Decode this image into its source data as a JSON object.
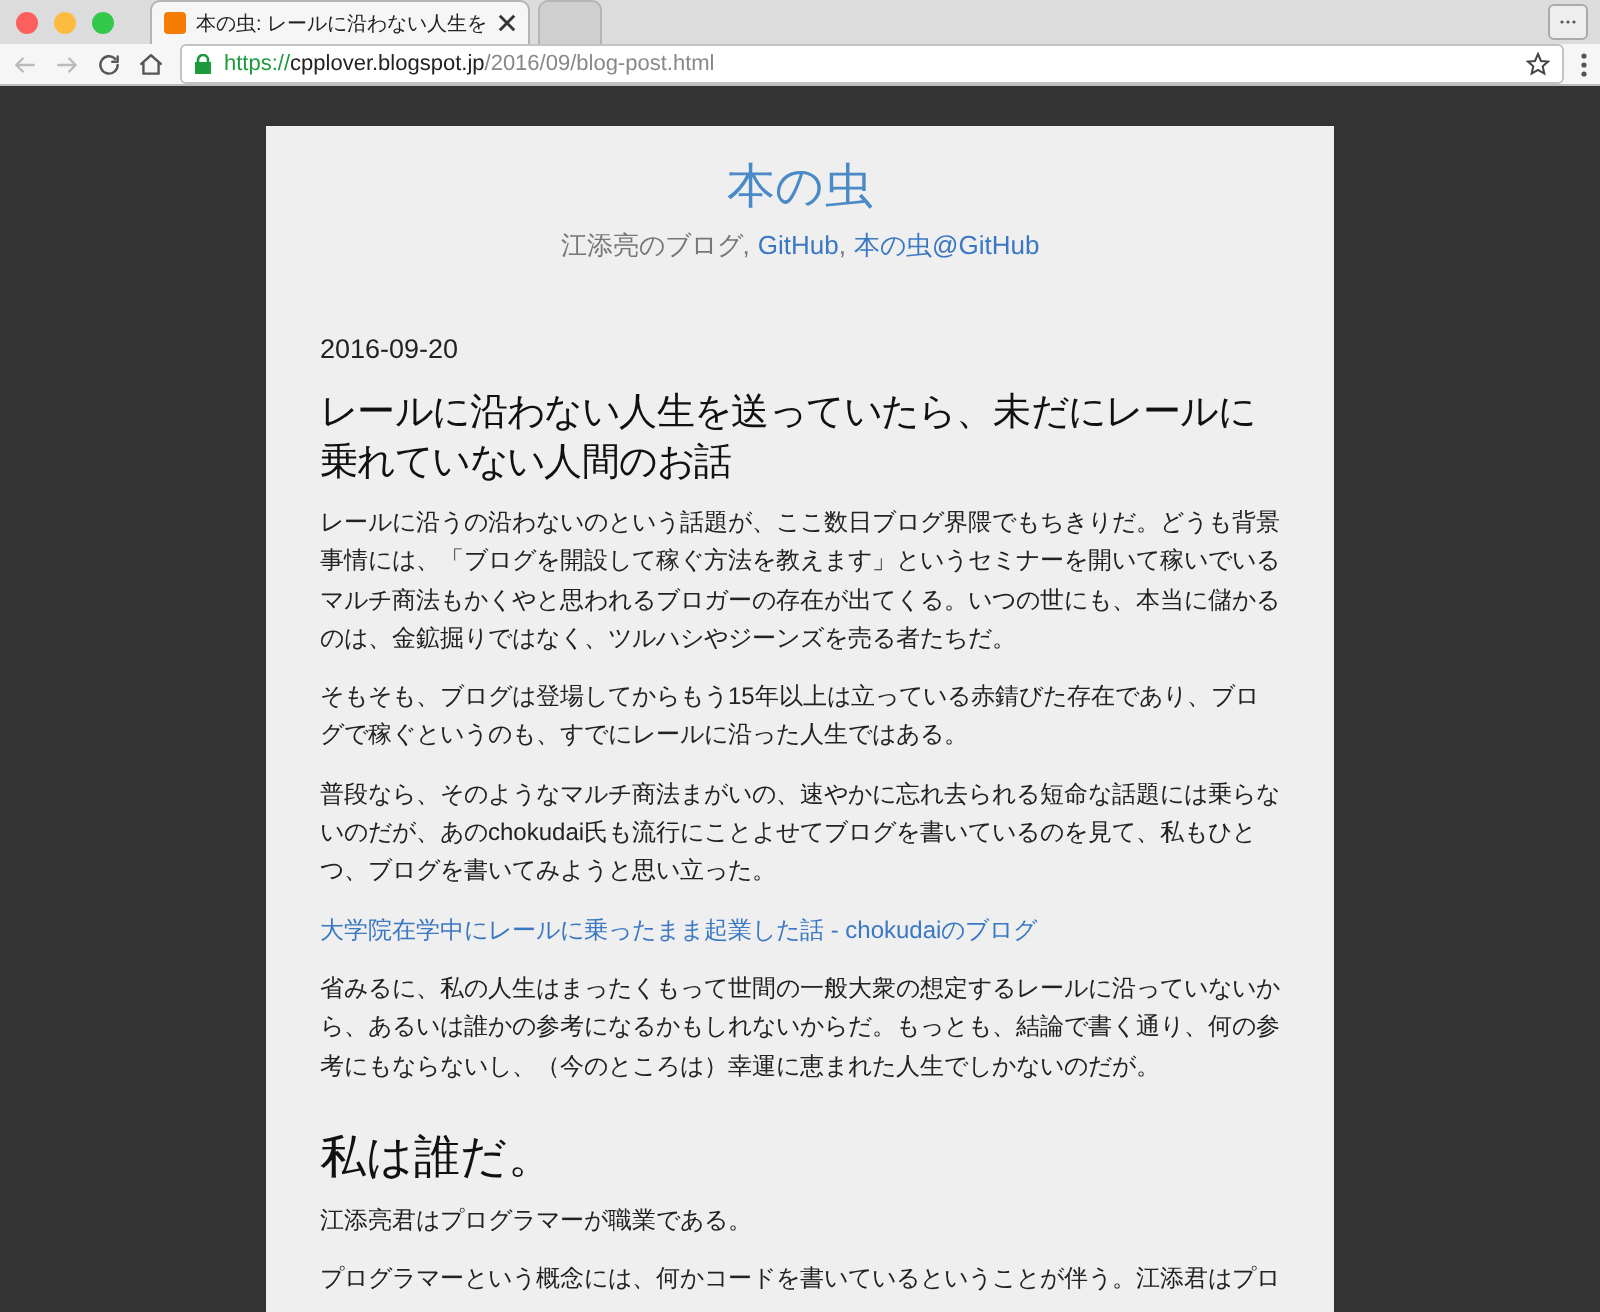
{
  "browser": {
    "tabs": [
      {
        "title": "本の虫: レールに沿わない人生を",
        "selected": true
      },
      {
        "selected": false
      }
    ],
    "url": {
      "scheme": "https://",
      "host": "cpplover.blogspot.jp",
      "path": "/2016/09/blog-post.html"
    }
  },
  "blog": {
    "title": "本の虫",
    "subtitle": {
      "text": "江添亮のブログ",
      "links": [
        {
          "separator": ",",
          "text": "GitHub"
        },
        {
          "separator": ",",
          "text": "本の虫@GitHub"
        }
      ]
    }
  },
  "post": {
    "date": "2016-09-20",
    "title": "レールに沿わない人生を送っていたら、未だにレールに乗れていない人間のお話",
    "blocks": [
      {
        "kind": "paragraph",
        "text": "レールに沿うの沿わないのという話題が、ここ数日ブログ界隈でもちきりだ。どうも背景事情には、「ブログを開設して稼ぐ方法を教えます」というセミナーを開いて稼いでいるマルチ商法もかくやと思われるブロガーの存在が出てくる。いつの世にも、本当に儲かるのは、金鉱掘りではなく、ツルハシやジーンズを売る者たちだ。"
      },
      {
        "kind": "paragraph",
        "text": "そもそも、ブログは登場してからもう15年以上は立っている赤錆びた存在であり、ブログで稼ぐというのも、すでにレールに沿った人生ではある。"
      },
      {
        "kind": "paragraph",
        "text": "普段なら、そのようなマルチ商法まがいの、速やかに忘れ去られる短命な話題には乗らないのだが、あのchokudai氏も流行にことよせてブログを書いているのを見て、私もひとつ、ブログを書いてみようと思い立った。"
      },
      {
        "kind": "link",
        "text": "大学院在学中にレールに乗ったまま起業した話 - chokudaiのブログ"
      },
      {
        "kind": "paragraph",
        "text": "省みるに、私の人生はまったくもって世間の一般大衆の想定するレールに沿っていないから、あるいは誰かの参考になるかもしれないからだ。もっとも、結論で書く通り、何の参考にもならないし、（今のところは）幸運に恵まれた人生でしかないのだが。"
      },
      {
        "kind": "heading",
        "text": "私は誰だ。"
      },
      {
        "kind": "paragraph",
        "text": "江添亮君はプログラマーが職業である。"
      },
      {
        "kind": "paragraph",
        "text": "プログラマーという概念には、何かコードを書いているということが伴う。江添君はプロ"
      }
    ]
  }
}
